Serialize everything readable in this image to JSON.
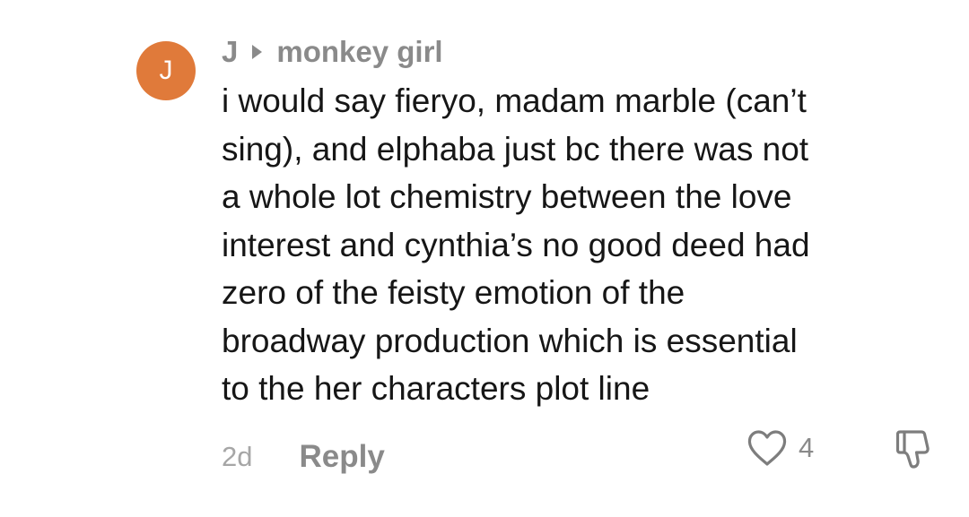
{
  "comment": {
    "avatar_initial": "J",
    "avatar_color": "#e07a3a",
    "author": "J",
    "reply_to": "monkey girl",
    "text": "i would say fieryo, madam marble (can’t\nsing), and elphaba just bc there was not\na whole lot chemistry between the love\ninterest and cynthia’s no good deed had\nzero of the feisty emotion of the\nbroadway production which is essential\nto the her characters plot line",
    "timestamp": "2d",
    "reply_label": "Reply",
    "like_icon": "heart-outline-icon",
    "like_count": "4",
    "dislike_icon": "thumbs-down-outline-icon"
  }
}
